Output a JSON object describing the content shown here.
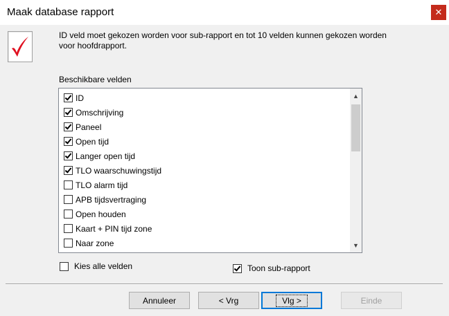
{
  "window": {
    "title": "Maak database rapport",
    "close_glyph": "✕"
  },
  "icon": {
    "name": "red-checkmark-icon",
    "color": "#e01020"
  },
  "info_text": "ID veld moet gekozen worden voor sub-rapport en tot 10 velden kunnen gekozen worden voor hoofdrapport.",
  "fields_label": "Beschikbare velden",
  "fields": [
    {
      "label": "ID",
      "checked": true
    },
    {
      "label": "Omschrijving",
      "checked": true
    },
    {
      "label": "Paneel",
      "checked": true
    },
    {
      "label": "Open tijd",
      "checked": true
    },
    {
      "label": "Langer open tijd",
      "checked": true
    },
    {
      "label": "TLO waarschuwingstijd",
      "checked": true
    },
    {
      "label": "TLO alarm tijd",
      "checked": false
    },
    {
      "label": "APB tijdsvertraging",
      "checked": false
    },
    {
      "label": "Open houden",
      "checked": false
    },
    {
      "label": "Kaart + PIN tijd zone",
      "checked": false
    },
    {
      "label": "Naar zone",
      "checked": false
    }
  ],
  "scrollbar": {
    "up_glyph": "▲",
    "down_glyph": "▼"
  },
  "select_all": {
    "label": "Kies alle velden",
    "checked": false
  },
  "show_subreport": {
    "label": "Toon sub-rapport",
    "checked": true
  },
  "buttons": {
    "cancel": "Annuleer",
    "back": "< Vrg",
    "next": "Vlg >",
    "finish": "Einde"
  }
}
